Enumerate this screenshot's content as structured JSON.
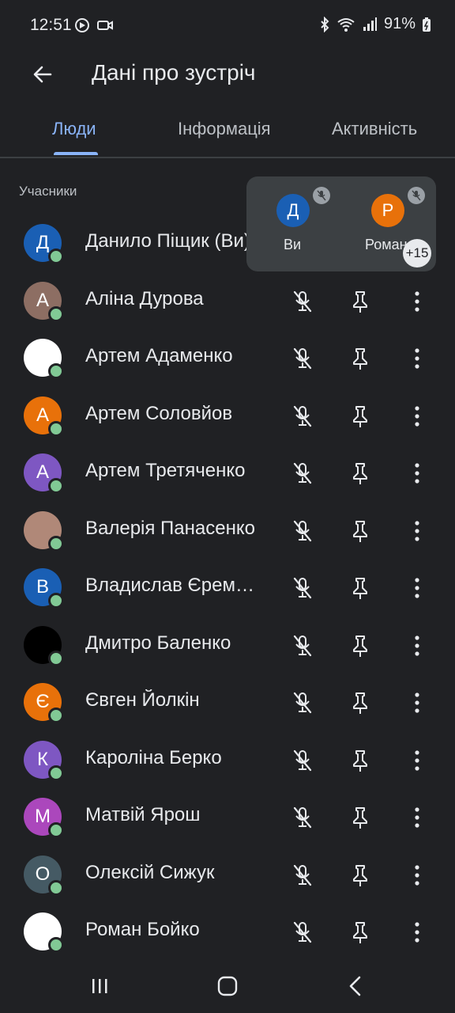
{
  "status_bar": {
    "time": "12:51",
    "battery": "91%",
    "icons": [
      "media-icon",
      "video-icon",
      "bluetooth-icon",
      "wifi-icon",
      "signal-icon",
      "battery-icon"
    ]
  },
  "header": {
    "title": "Дані про зустріч",
    "back_icon": "arrow-left-icon"
  },
  "tabs": [
    {
      "label": "Люди",
      "active": true
    },
    {
      "label": "Інформація",
      "active": false
    },
    {
      "label": "Активність",
      "active": false
    }
  ],
  "section_label": "Учасники",
  "participants": [
    {
      "name": "Данило Піщик (Ви)",
      "initial": "Д",
      "avatar_color": "#1a5fb4"
    },
    {
      "name": "Аліна Дурова",
      "initial": "А",
      "avatar_color": "#8d6e63"
    },
    {
      "name": "Артем Адаменко",
      "initial": "",
      "avatar_color": "#ffffff"
    },
    {
      "name": "Артем Соловйов",
      "initial": "А",
      "avatar_color": "#e8710a"
    },
    {
      "name": "Артем Третяченко",
      "initial": "А",
      "avatar_color": "#7e57c2"
    },
    {
      "name": "Валерія Панасенко",
      "initial": "",
      "avatar_color": "#b08878"
    },
    {
      "name": "Владислав Єременко",
      "initial": "В",
      "avatar_color": "#1a5fb4"
    },
    {
      "name": "Дмитро Баленко",
      "initial": "",
      "avatar_color": "#000000"
    },
    {
      "name": "Євген Йолкін",
      "initial": "Є",
      "avatar_color": "#e8710a"
    },
    {
      "name": "Кароліна Берко",
      "initial": "К",
      "avatar_color": "#7e57c2"
    },
    {
      "name": "Матвій Ярош",
      "initial": "М",
      "avatar_color": "#ab47bc"
    },
    {
      "name": "Олексій Сижук",
      "initial": "О",
      "avatar_color": "#455a64"
    },
    {
      "name": "Роман Бойко",
      "initial": "",
      "avatar_color": "#ffffff"
    }
  ],
  "floating_tile": {
    "self": {
      "initial": "Д",
      "label": "Ви",
      "color": "#1a5fb4"
    },
    "other": {
      "initial": "Р",
      "label": "Роман",
      "color": "#e8710a"
    },
    "overflow": "+15"
  },
  "nav": {
    "icons": [
      "recent-apps-icon",
      "home-icon",
      "back-icon"
    ]
  }
}
